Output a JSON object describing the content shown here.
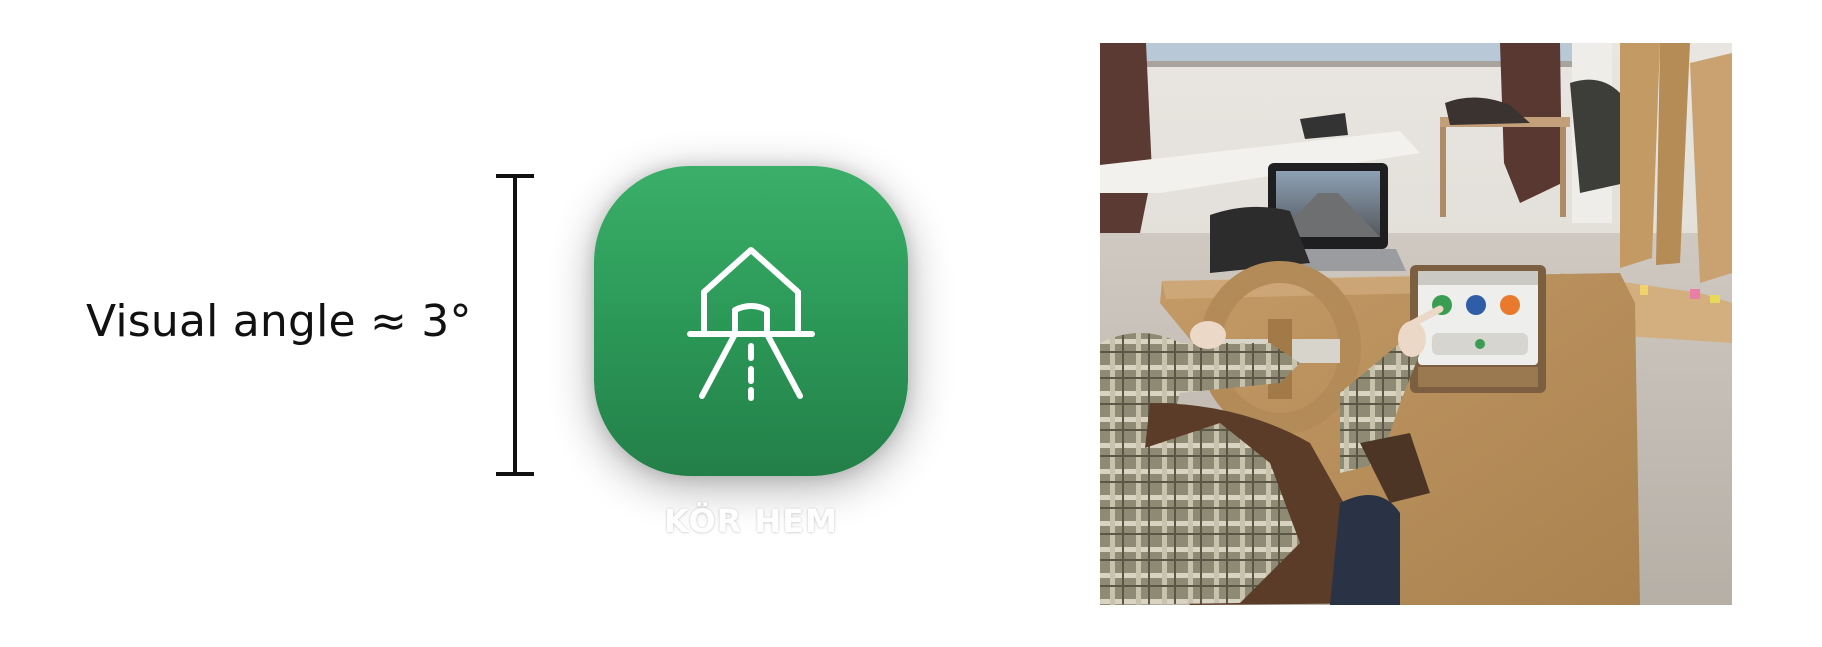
{
  "label": {
    "text": "Visual angle ≈ 3°"
  },
  "app_icon": {
    "name": "KÖR HEM",
    "icon": "house-road-icon",
    "background_color": "#2e9c5b",
    "glyph_color": "#ffffff"
  },
  "photo": {
    "content": "participant-using-cardboard-driving-simulator-photo",
    "tablet_icons": [
      "green-app-icon",
      "blue-app-icon",
      "orange-radio-icon"
    ]
  }
}
